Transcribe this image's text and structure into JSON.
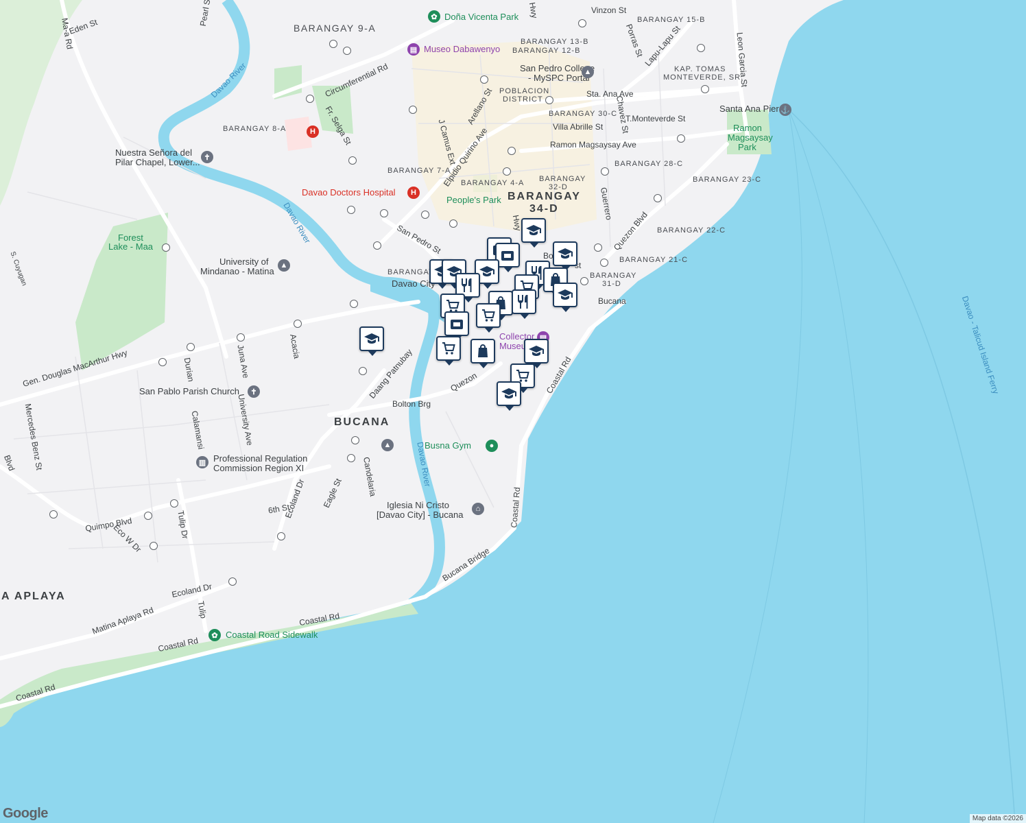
{
  "map": {
    "attribution": "Map data ©2026",
    "logo": "Google",
    "colors": {
      "water": "#8fd7ee",
      "land": "#f2f2f4",
      "park": "#c9e9c9",
      "road": "#ffffff",
      "pin_border": "#1d3a5c"
    }
  },
  "labels": {
    "areas": [
      {
        "text": "BARANGAY 9-A"
      },
      {
        "text": "BARANGAY 15-B"
      },
      {
        "text": "BARANGAY 13-B"
      },
      {
        "text": "BARANGAY 12-B"
      },
      {
        "text": "KAP. TOMAS"
      },
      {
        "text": "MONTEVERDE, SR."
      },
      {
        "text": "POBLACION"
      },
      {
        "text": "DISTRICT"
      },
      {
        "text": "BARANGAY 30-C"
      },
      {
        "text": "BARANGAY 8-A"
      },
      {
        "text": "BARANGAY 7-A"
      },
      {
        "text": "BARANGAY 4-A"
      },
      {
        "text": "BARANGAY"
      },
      {
        "text": "32-D"
      },
      {
        "text": "BARANGAY 28-C"
      },
      {
        "text": "BARANGAY 23-C"
      },
      {
        "text": "BARANGAY 22-C"
      },
      {
        "text": "BARANGAY 21-C"
      },
      {
        "text": "BARANGAY"
      },
      {
        "text": "31-D"
      },
      {
        "text": "BARANGAY"
      },
      {
        "text": "34-D"
      },
      {
        "text": "BARANGAY"
      },
      {
        "text": "BUCANA"
      },
      {
        "text": "A APLAYA"
      }
    ],
    "pois": [
      {
        "text": "Doña Vicenta Park",
        "kind": "park"
      },
      {
        "text": "Museo Dabawenyo",
        "kind": "museum"
      },
      {
        "text": "San Pedro College"
      },
      {
        "text": "- MySPC Portal"
      },
      {
        "text": "Santa Ana Pier"
      },
      {
        "text": "Ramon",
        "kind": "park"
      },
      {
        "text": "Magsaysay",
        "kind": "park"
      },
      {
        "text": "Park",
        "kind": "park"
      },
      {
        "text": "Nuestra Señora del"
      },
      {
        "text": "Pilar Chapel, Lower..."
      },
      {
        "text": "Davao Doctors Hospital",
        "kind": "medical"
      },
      {
        "text": "People's Park",
        "kind": "park"
      },
      {
        "text": "Forest",
        "kind": "park"
      },
      {
        "text": "Lake - Maa",
        "kind": "park"
      },
      {
        "text": "University of"
      },
      {
        "text": "Mindanao - Matina"
      },
      {
        "text": "Davao City"
      },
      {
        "text": "Collector",
        "kind": "museum"
      },
      {
        "text": "Museum",
        "kind": "museum"
      },
      {
        "text": "San Pablo Parish Church"
      },
      {
        "text": "Professional Regulation"
      },
      {
        "text": "Commission Region XI"
      },
      {
        "text": "Busna Gym",
        "kind": "park"
      },
      {
        "text": "Iglesia Ni Cristo"
      },
      {
        "text": "[Davao City] - Bucana"
      },
      {
        "text": "Coastal Road Sidewalk",
        "kind": "park"
      }
    ],
    "roads": [
      {
        "text": "Ma-a Rd"
      },
      {
        "text": "Eden St"
      },
      {
        "text": "Pearl St"
      },
      {
        "text": "Circumferential Rd"
      },
      {
        "text": "Fr. Selga St"
      },
      {
        "text": "J Camus Ext"
      },
      {
        "text": "Arellano St"
      },
      {
        "text": "Elpidio Quirino Ave"
      },
      {
        "text": "San Pedro St"
      },
      {
        "text": "Sta. Ana Ave"
      },
      {
        "text": "T.Monteverde St"
      },
      {
        "text": "Villa Abrille St"
      },
      {
        "text": "Ramon Magsaysay Ave"
      },
      {
        "text": "Chavez St"
      },
      {
        "text": "Guerrero"
      },
      {
        "text": "Quezon Blvd"
      },
      {
        "text": "Lapu-Lapu St"
      },
      {
        "text": "Porras St"
      },
      {
        "text": "Leon Garcia St"
      },
      {
        "text": "Vinzon St"
      },
      {
        "text": "Bucana"
      },
      {
        "text": "Gen. Douglas MacArthur Hwy"
      },
      {
        "text": "Acacia"
      },
      {
        "text": "Juna Ave"
      },
      {
        "text": "Durian"
      },
      {
        "text": "University Ave"
      },
      {
        "text": "Daang Patnubay"
      },
      {
        "text": "Bolton Brg"
      },
      {
        "text": "Quezon"
      },
      {
        "text": "Coastal Rd"
      },
      {
        "text": "Mercedes Benz St"
      },
      {
        "text": "Calamansi"
      },
      {
        "text": "Ecoland Dr"
      },
      {
        "text": "Eagle St"
      },
      {
        "text": "Candelaria"
      },
      {
        "text": "6th St"
      },
      {
        "text": "Quimpo Blvd"
      },
      {
        "text": "Eco W Dr"
      },
      {
        "text": "Tulip Dr"
      },
      {
        "text": "Tulip"
      },
      {
        "text": "Ecoland Dr"
      },
      {
        "text": "Matina Aplaya Rd"
      },
      {
        "text": "Bucana Bridge"
      },
      {
        "text": "Coastal Rd"
      },
      {
        "text": "Coastal Rd"
      },
      {
        "text": "Coastal Rd"
      },
      {
        "text": "Coastal Rd"
      },
      {
        "text": "S. Cuyugan"
      },
      {
        "text": "Hwy"
      },
      {
        "text": "Hwy"
      },
      {
        "text": "Bo"
      },
      {
        "text": "st"
      },
      {
        "text": "Blvd"
      }
    ],
    "water": [
      {
        "text": "Davao River"
      },
      {
        "text": "Davao River"
      },
      {
        "text": "Davao River"
      },
      {
        "text": "Davao - Talicud Island Ferry"
      }
    ]
  },
  "pins": [
    {
      "icon": "school-icon"
    },
    {
      "icon": "school-icon"
    },
    {
      "icon": "school-icon"
    },
    {
      "icon": "school-icon"
    },
    {
      "icon": "school-icon"
    },
    {
      "icon": "school-icon"
    },
    {
      "icon": "school-icon"
    },
    {
      "icon": "school-icon"
    },
    {
      "icon": "shopping-cart-icon"
    },
    {
      "icon": "shopping-cart-icon"
    },
    {
      "icon": "shopping-cart-icon"
    },
    {
      "icon": "shopping-cart-icon"
    },
    {
      "icon": "shopping-cart-icon"
    },
    {
      "icon": "restaurant-icon"
    },
    {
      "icon": "restaurant-icon"
    },
    {
      "icon": "restaurant-icon"
    },
    {
      "icon": "shopping-bag-icon"
    },
    {
      "icon": "shopping-bag-icon"
    },
    {
      "icon": "shopping-bag-icon"
    },
    {
      "icon": "store-icon"
    },
    {
      "icon": "store-icon"
    },
    {
      "icon": "store-icon"
    }
  ]
}
